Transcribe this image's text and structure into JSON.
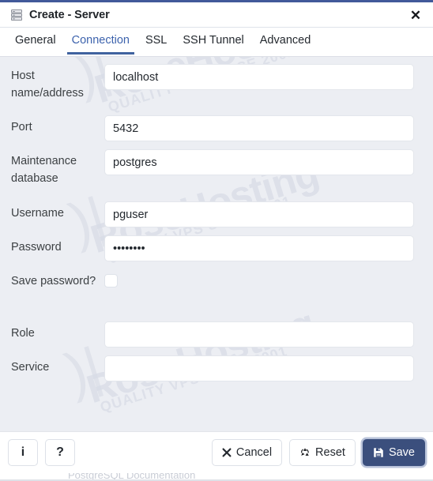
{
  "dialog": {
    "title": "Create - Server",
    "title_icon": "server-icon",
    "close_icon": "✕",
    "accent_color": "#42599a"
  },
  "tabs": [
    {
      "label": "General",
      "active": false
    },
    {
      "label": "Connection",
      "active": true
    },
    {
      "label": "SSL",
      "active": false
    },
    {
      "label": "SSH Tunnel",
      "active": false
    },
    {
      "label": "Advanced",
      "active": false
    }
  ],
  "form": {
    "fields": [
      {
        "label": "Host name/address",
        "value": "localhost",
        "placeholder": "",
        "type": "text"
      },
      {
        "label": "Port",
        "value": "5432",
        "placeholder": "",
        "type": "text"
      },
      {
        "label": "Maintenance database",
        "value": "postgres",
        "placeholder": "",
        "type": "text"
      },
      {
        "label": "Username",
        "value": "pguser",
        "placeholder": "",
        "type": "text"
      },
      {
        "label": "Password",
        "value": "••••••••",
        "placeholder": "",
        "type": "password"
      },
      {
        "label": "Save password?",
        "value": "",
        "placeholder": "",
        "type": "checkbox",
        "checked": false
      },
      {
        "label": "Role",
        "value": "",
        "placeholder": "",
        "type": "text"
      },
      {
        "label": "Service",
        "value": "",
        "placeholder": "",
        "type": "text"
      }
    ]
  },
  "watermark": {
    "main": "RoseHosting",
    "sub": "QUALITY VPS SINCE 2001"
  },
  "footer": {
    "info_label": "i",
    "help_label": "?",
    "cancel_label": "Cancel",
    "reset_label": "Reset",
    "save_label": "Save",
    "save_color": "#3b4f7d"
  },
  "background": {
    "partial_text": "PostgreSQL Documentation"
  }
}
